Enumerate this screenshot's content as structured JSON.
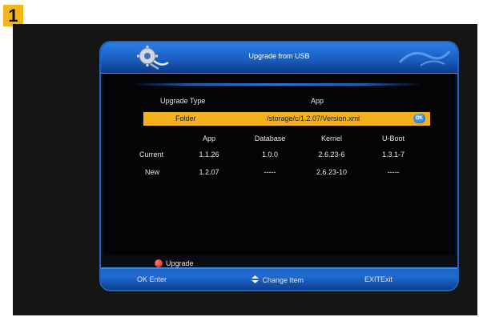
{
  "step_badge": "1",
  "dialog": {
    "title": "Upgrade from USB"
  },
  "header": {
    "type_label": "Upgrade Type",
    "type_value": "App"
  },
  "folder": {
    "label": "Folder",
    "path": "/storage/c/1.2.07/Version.xml",
    "ok_icon_text": "OK"
  },
  "table": {
    "columns": [
      "App",
      "Database",
      "Kernel",
      "U-Boot"
    ],
    "rows": [
      {
        "label": "Current",
        "values": [
          "1.1.26",
          "1.0.0",
          "2.6.23-6",
          "1.3.1-7"
        ]
      },
      {
        "label": "New",
        "values": [
          "1.2.07",
          "-----",
          "2.6.23-10",
          "-----"
        ]
      }
    ]
  },
  "actions": {
    "upgrade_label": "Upgrade"
  },
  "footer": {
    "ok_key": "OK",
    "ok_label": "Enter",
    "change_label": "Change Item",
    "exit_key": "EXIT",
    "exit_label": "Exit"
  },
  "colors": {
    "highlight": "#f3b21d",
    "frame_blue": "#1f64b8",
    "red_button": "#d4190f"
  },
  "icons": [
    "gear-icon",
    "ok-icon",
    "red-dot-icon",
    "updown-arrows-icon"
  ]
}
